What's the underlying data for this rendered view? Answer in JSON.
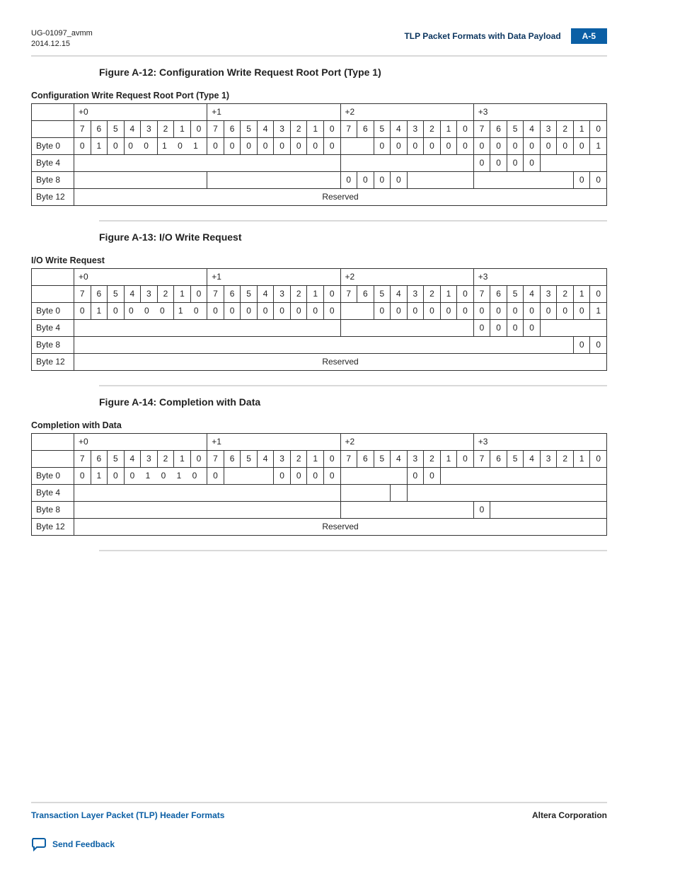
{
  "header": {
    "doc_id": "UG-01097_avmm",
    "date": "2014.12.15",
    "section_title": "TLP Packet Formats with Data Payload",
    "page_badge": "A-5"
  },
  "figures": [
    {
      "title": "Figure A-12: Configuration Write Request Root Port (Type 1)",
      "caption": "Configuration Write Request Root Port (Type 1)",
      "byte_offsets": [
        "+0",
        "+1",
        "+2",
        "+3"
      ],
      "bit_labels": [
        "7",
        "6",
        "5",
        "4",
        "3",
        "2",
        "1",
        "0",
        "7",
        "6",
        "5",
        "4",
        "3",
        "2",
        "1",
        "0",
        "7",
        "6",
        "5",
        "4",
        "3",
        "2",
        "1",
        "0",
        "7",
        "6",
        "5",
        "4",
        "3",
        "2",
        "1",
        "0"
      ],
      "rows": [
        {
          "label": "Byte 0",
          "cells": [
            {
              "text": "0",
              "span": 1
            },
            {
              "text": "1",
              "span": 1
            },
            {
              "text": "0",
              "span": 1
            },
            {
              "text": "0  0",
              "span": 2
            },
            {
              "text": "1  0  1",
              "span": 3
            },
            {
              "text": "0",
              "span": 1
            },
            {
              "text": "0",
              "span": 1
            },
            {
              "text": "0",
              "span": 1
            },
            {
              "text": "0",
              "span": 1
            },
            {
              "text": "0",
              "span": 1
            },
            {
              "text": "0",
              "span": 1
            },
            {
              "text": "0",
              "span": 1
            },
            {
              "text": "0",
              "span": 1
            },
            {
              "text": "",
              "span": 2
            },
            {
              "text": "0",
              "span": 1
            },
            {
              "text": "0",
              "span": 1
            },
            {
              "text": "0",
              "span": 1
            },
            {
              "text": "0",
              "span": 1
            },
            {
              "text": "0",
              "span": 1
            },
            {
              "text": "0",
              "span": 1
            },
            {
              "text": "0",
              "span": 1
            },
            {
              "text": "0",
              "span": 1
            },
            {
              "text": "0",
              "span": 1
            },
            {
              "text": "0",
              "span": 1
            },
            {
              "text": "0",
              "span": 1
            },
            {
              "text": "0",
              "span": 1
            },
            {
              "text": "0",
              "span": 1
            },
            {
              "text": "1",
              "span": 1
            }
          ]
        },
        {
          "label": "Byte 4",
          "cells": [
            {
              "text": "",
              "span": 16
            },
            {
              "text": "",
              "span": 8
            },
            {
              "text": "0",
              "span": 1
            },
            {
              "text": "0",
              "span": 1
            },
            {
              "text": "0",
              "span": 1
            },
            {
              "text": "0",
              "span": 1
            },
            {
              "text": "",
              "span": 4
            }
          ]
        },
        {
          "label": "Byte 8",
          "cells": [
            {
              "text": "",
              "span": 8
            },
            {
              "text": "",
              "span": 8
            },
            {
              "text": "0",
              "span": 1
            },
            {
              "text": "0",
              "span": 1
            },
            {
              "text": "0",
              "span": 1
            },
            {
              "text": "0",
              "span": 1
            },
            {
              "text": "",
              "span": 4
            },
            {
              "text": "",
              "span": 6
            },
            {
              "text": "0",
              "span": 1
            },
            {
              "text": "0",
              "span": 1
            }
          ]
        },
        {
          "label": "Byte 12",
          "cells": [
            {
              "text": "Reserved",
              "span": 32
            }
          ]
        }
      ]
    },
    {
      "title": "Figure A-13: I/O Write Request",
      "caption": "I/O Write Request",
      "byte_offsets": [
        "+0",
        "+1",
        "+2",
        "+3"
      ],
      "bit_labels": [
        "7",
        "6",
        "5",
        "4",
        "3",
        "2",
        "1",
        "0",
        "7",
        "6",
        "5",
        "4",
        "3",
        "2",
        "1",
        "0",
        "7",
        "6",
        "5",
        "4",
        "3",
        "2",
        "1",
        "0",
        "7",
        "6",
        "5",
        "4",
        "3",
        "2",
        "1",
        "0"
      ],
      "rows": [
        {
          "label": "Byte 0",
          "cells": [
            {
              "text": "0",
              "span": 1
            },
            {
              "text": "1",
              "span": 1
            },
            {
              "text": "0",
              "span": 1
            },
            {
              "text": "0  0  0",
              "span": 3
            },
            {
              "text": "1  0",
              "span": 2
            },
            {
              "text": "0",
              "span": 1
            },
            {
              "text": "0",
              "span": 1
            },
            {
              "text": "0",
              "span": 1
            },
            {
              "text": "0",
              "span": 1
            },
            {
              "text": "0",
              "span": 1
            },
            {
              "text": "0",
              "span": 1
            },
            {
              "text": "0",
              "span": 1
            },
            {
              "text": "0",
              "span": 1
            },
            {
              "text": "",
              "span": 2
            },
            {
              "text": "0",
              "span": 1
            },
            {
              "text": "0",
              "span": 1
            },
            {
              "text": "0",
              "span": 1
            },
            {
              "text": "0",
              "span": 1
            },
            {
              "text": "0",
              "span": 1
            },
            {
              "text": "0",
              "span": 1
            },
            {
              "text": "0",
              "span": 1
            },
            {
              "text": "0",
              "span": 1
            },
            {
              "text": "0",
              "span": 1
            },
            {
              "text": "0",
              "span": 1
            },
            {
              "text": "0",
              "span": 1
            },
            {
              "text": "0",
              "span": 1
            },
            {
              "text": "0",
              "span": 1
            },
            {
              "text": "1",
              "span": 1
            }
          ]
        },
        {
          "label": "Byte 4",
          "cells": [
            {
              "text": "",
              "span": 16
            },
            {
              "text": "",
              "span": 8
            },
            {
              "text": "0",
              "span": 1
            },
            {
              "text": "0",
              "span": 1
            },
            {
              "text": "0",
              "span": 1
            },
            {
              "text": "0",
              "span": 1
            },
            {
              "text": "",
              "span": 4
            }
          ]
        },
        {
          "label": "Byte 8",
          "cells": [
            {
              "text": "",
              "span": 30
            },
            {
              "text": "0",
              "span": 1
            },
            {
              "text": "0",
              "span": 1
            }
          ]
        },
        {
          "label": "Byte 12",
          "cells": [
            {
              "text": "Reserved",
              "span": 32
            }
          ]
        }
      ]
    },
    {
      "title": "Figure A-14: Completion with Data",
      "caption": "Completion with Data",
      "byte_offsets": [
        "+0",
        "+1",
        "+2",
        "+3"
      ],
      "bit_labels": [
        "7",
        "6",
        "5",
        "4",
        "3",
        "2",
        "1",
        "0",
        "7",
        "6",
        "5",
        "4",
        "3",
        "2",
        "1",
        "0",
        "7",
        "6",
        "5",
        "4",
        "3",
        "2",
        "1",
        "0",
        "7",
        "6",
        "5",
        "4",
        "3",
        "2",
        "1",
        "0"
      ],
      "rows": [
        {
          "label": "Byte 0",
          "cells": [
            {
              "text": "0",
              "span": 1
            },
            {
              "text": "1",
              "span": 1
            },
            {
              "text": "0",
              "span": 1
            },
            {
              "text": "0  1  0  1  0",
              "span": 5
            },
            {
              "text": "0",
              "span": 1
            },
            {
              "text": "",
              "span": 3
            },
            {
              "text": "0",
              "span": 1
            },
            {
              "text": "0",
              "span": 1
            },
            {
              "text": "0",
              "span": 1
            },
            {
              "text": "0",
              "span": 1
            },
            {
              "text": "",
              "span": 4
            },
            {
              "text": "0",
              "span": 1
            },
            {
              "text": "0",
              "span": 1
            },
            {
              "text": "",
              "span": 10
            }
          ]
        },
        {
          "label": "Byte 4",
          "cells": [
            {
              "text": "",
              "span": 16
            },
            {
              "text": "",
              "span": 3
            },
            {
              "text": "",
              "span": 1
            },
            {
              "text": "",
              "span": 12
            }
          ]
        },
        {
          "label": "Byte 8",
          "cells": [
            {
              "text": "",
              "span": 16
            },
            {
              "text": "",
              "span": 8
            },
            {
              "text": "0",
              "span": 1
            },
            {
              "text": "",
              "span": 7
            }
          ]
        },
        {
          "label": "Byte 12",
          "cells": [
            {
              "text": "Reserved",
              "span": 32
            }
          ]
        }
      ]
    }
  ],
  "footer": {
    "left": "Transaction Layer Packet (TLP) Header Formats",
    "right": "Altera Corporation",
    "feedback": "Send Feedback"
  }
}
